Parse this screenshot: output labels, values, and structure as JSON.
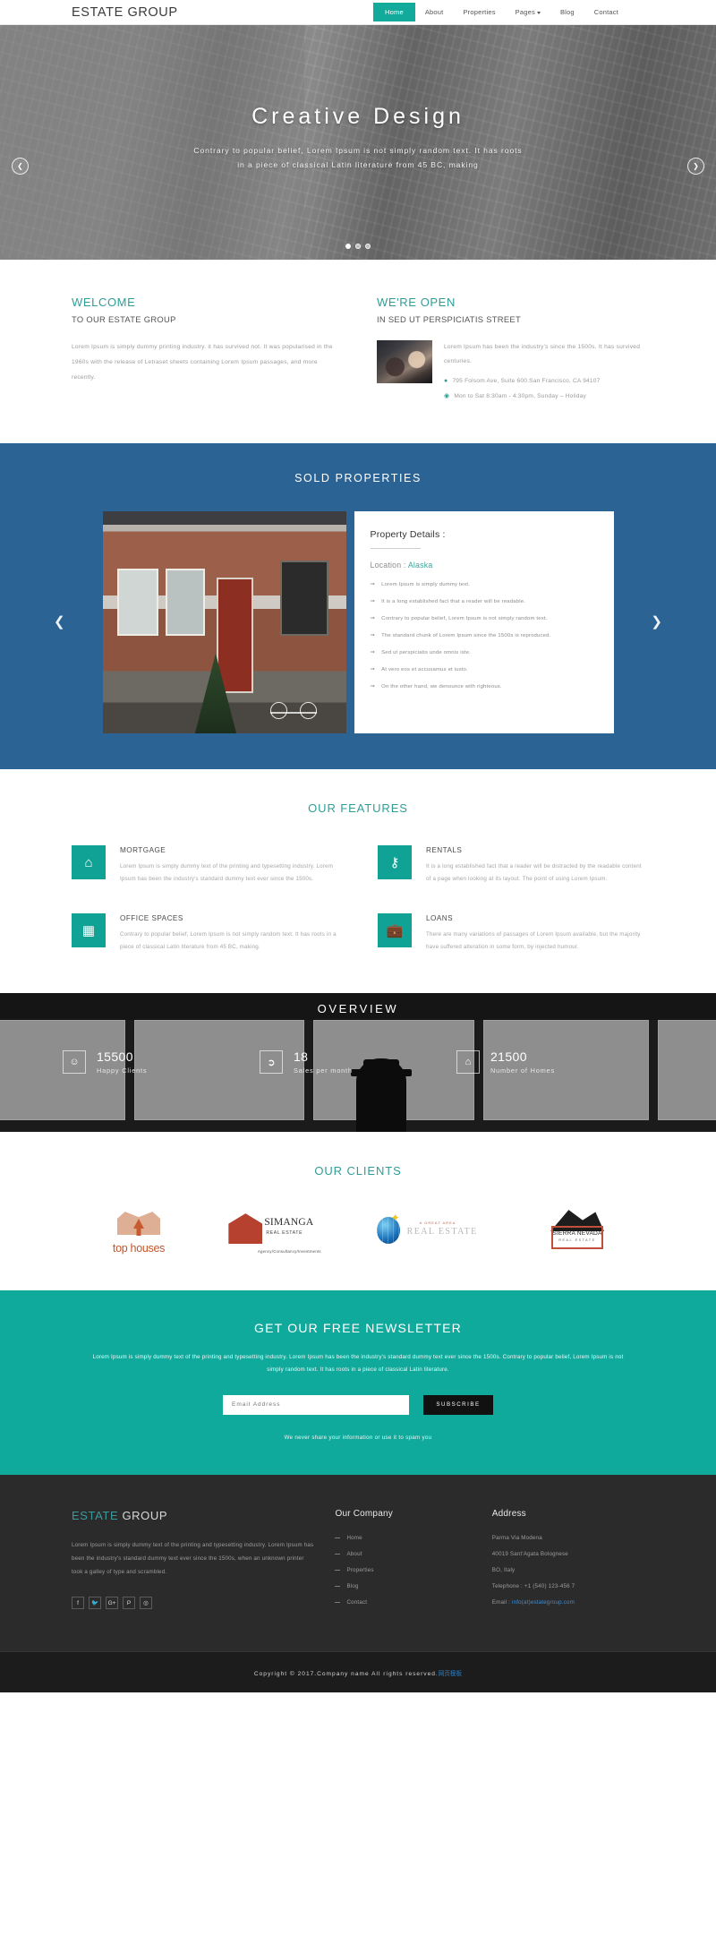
{
  "header": {
    "brand": "ESTATE GROUP",
    "nav": [
      {
        "label": "Home",
        "active": true
      },
      {
        "label": "About",
        "active": false
      },
      {
        "label": "Properties",
        "active": false
      },
      {
        "label": "Pages",
        "active": false,
        "caret": true
      },
      {
        "label": "Blog",
        "active": false
      },
      {
        "label": "Contact",
        "active": false
      }
    ]
  },
  "hero": {
    "title": "Creative Design",
    "line1": "Contrary to popular belief, Lorem Ipsum is not simply random text. It has roots",
    "line2": "in a piece of classical Latin literature from 45 BC, making",
    "prev_icon": "chevron-left",
    "next_icon": "chevron-right",
    "slides": 3,
    "active_slide": 1
  },
  "welcome": {
    "title": "WELCOME",
    "subtitle": "TO OUR ESTATE GROUP",
    "text": "Lorem Ipsum is simply dummy printing industry. it has survived not. It was popularised in the 1960s with the release of Letraset sheets containing Lorem Ipsum passages, and more recently."
  },
  "open": {
    "title": "WE'RE OPEN",
    "subtitle": "IN SED UT PERSPICIATIS STREET",
    "text": "Lorem Ipsum has been the industry's since the 1500s. It has survived centuries.",
    "address": "795 Folsom Ave, Suite 600.San Francisco, CA 94107",
    "hours": "Mon to Sat 8:30am - 4:30pm, Sunday – Holiday",
    "address_icon": "map-marker-icon",
    "hours_icon": "clock-icon"
  },
  "sold": {
    "title": "SOLD PROPERTIES",
    "card_title": "Property Details :",
    "location_label": "Location : ",
    "location_value": "Alaska",
    "bullets": [
      "Lorem Ipsum is simply dummy text.",
      "It is a long established fact that a reader will be readable.",
      "Contrary to popular belief, Lorem Ipsum is not simply random text.",
      "The standard chunk of Lorem Ipsum since the 1500s is reproduced.",
      "Sed ut perspiciatis unde omnis iste.",
      "At vero eos et accusamus et iusto.",
      "On the other hand, we denounce with righteous."
    ],
    "prev_icon": "chevron-left",
    "next_icon": "chevron-right",
    "bg_color": "#2c6395"
  },
  "features": {
    "title": "OUR FEATURES",
    "items": [
      {
        "icon": "home-icon",
        "glyph": "⌂",
        "title": "MORTGAGE",
        "text": "Lorem Ipsum is simply dummy text of the printing and typesetting industry. Lorem Ipsum has been the industry's standard dummy text ever since the 1500s."
      },
      {
        "icon": "key-icon",
        "glyph": "⚷",
        "title": "RENTALS",
        "text": "It is a long established fact that a reader will be distracted by the readable content of a page when looking at its layout. The point of using Lorem Ipsum."
      },
      {
        "icon": "building-icon",
        "glyph": "☷",
        "title": "OFFICE SPACES",
        "text": "Contrary to popular belief, Lorem Ipsum is not simply random text. It has roots in a piece of classical Latin literature from 45 BC, making."
      },
      {
        "icon": "briefcase-icon",
        "glyph": "▭",
        "title": "LOANS",
        "text": "There are many variations of passages of Lorem Ipsum available, but the majority have suffered alteration in some form, by injected humour."
      }
    ],
    "accent_color": "#11a296"
  },
  "overview": {
    "title": "OVERVIEW",
    "stats": [
      {
        "icon": "smiley-icon",
        "glyph": "☺",
        "number": "15500",
        "label": "Happy Clients"
      },
      {
        "icon": "tag-icon",
        "glyph": "Ἷ7",
        "number": "18",
        "label": "Sales per month"
      },
      {
        "icon": "home-icon",
        "glyph": "⌂",
        "number": "21500",
        "label": "Number of Homes"
      }
    ]
  },
  "clients": {
    "title": "OUR CLIENTS",
    "logos": [
      {
        "name": "top-houses-logo",
        "text": "top houses"
      },
      {
        "name": "simanga-logo",
        "text": "SIMANGA",
        "sub": "REAL ESTATE",
        "tagline": "Agency/Consultancy/Investments"
      },
      {
        "name": "real-estate-globe-logo",
        "small": "A GREAT AREA",
        "text": "REAL ESTATE"
      },
      {
        "name": "sierra-nevada-logo",
        "text": "SIERRA NEVADA",
        "sub": "REAL ESTATE"
      }
    ]
  },
  "newsletter": {
    "title": "GET OUR FREE NEWSLETTER",
    "text": "Lorem Ipsum is simply dummy text of the printing and typesetting industry. Lorem Ipsum has been the industry's standard dummy text ever since the 1500s. Contrary to popular belief, Lorem Ipsum is not simply random text. It has roots in a piece of classical Latin literature.",
    "placeholder": "Email Address",
    "value": "",
    "button": "SUBSCRIBE",
    "note": "We never share your information or use it to spam you",
    "bg_color": "#10aa9c"
  },
  "footer": {
    "brand_a": "ESTATE ",
    "brand_b": "GROUP",
    "about": "Lorem Ipsum is simply dummy text of the printing and typesetting industry. Lorem Ipsum has been the industry's standard dummy text ever since the 1500s, when an unknown printer took a galley of type and scrambled.",
    "socials": [
      {
        "name": "facebook-icon",
        "glyph": "f"
      },
      {
        "name": "twitter-icon",
        "glyph": "✉"
      },
      {
        "name": "google-plus-icon",
        "glyph": "G+"
      },
      {
        "name": "pinterest-icon",
        "glyph": "P"
      },
      {
        "name": "dribbble-icon",
        "glyph": "◎"
      }
    ],
    "company_head": "Our Company",
    "company_links": [
      "Home",
      "About",
      "Properties",
      "Blog",
      "Contact"
    ],
    "address_head": "Address",
    "address_lines": [
      "Parma Via Modena",
      "40019 Sant'Agata Bolognese",
      "BO, Italy",
      "Telephone : +1 (540) 123-456 7"
    ],
    "email_label": "Email : ",
    "email_value": "info(at)estategroup.com",
    "copyright": "Copyright © 2017.Company name All rights reserved.",
    "copyright_cn": "网页模板"
  }
}
